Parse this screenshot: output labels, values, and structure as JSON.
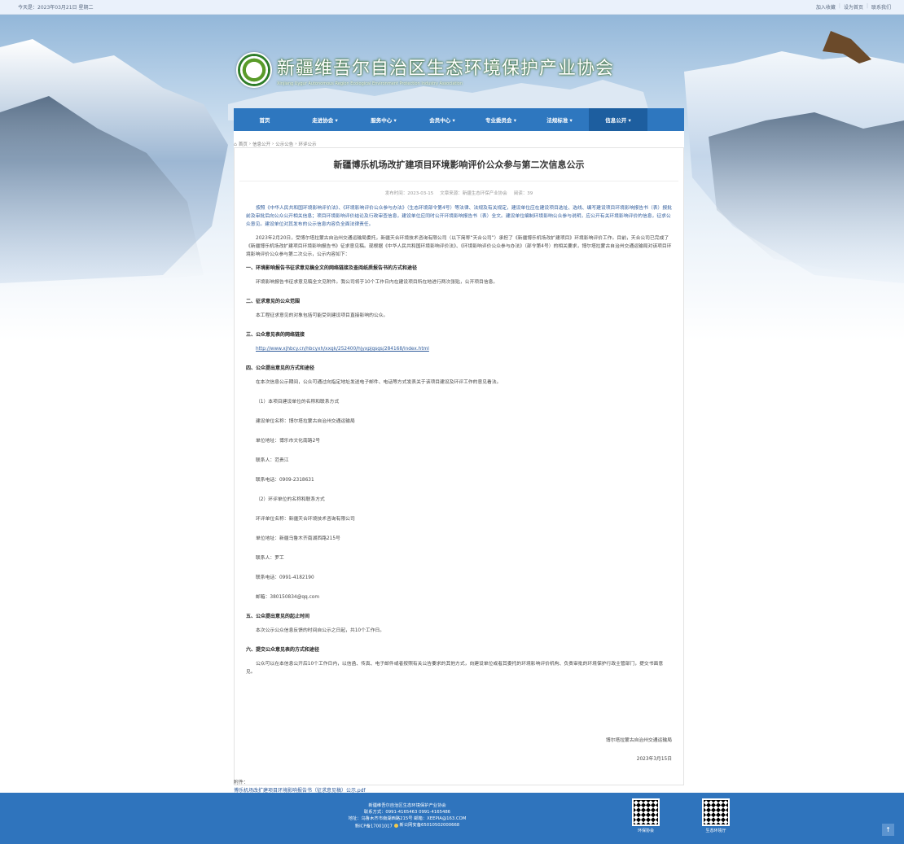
{
  "topbar": {
    "date": "今天是：2023年03月21日 星期二",
    "links": [
      "加入收藏",
      "设为首页",
      "联系我们"
    ]
  },
  "logo": {
    "title": "新疆维吾尔自治区生态环境保护产业协会",
    "subtitle": "Xinjiang Uygur Autonomous Region Ecological Environment Protection Industry Association"
  },
  "nav": [
    {
      "label": "首页",
      "active": false
    },
    {
      "label": "走进协会 ▾",
      "active": false
    },
    {
      "label": "服务中心 ▾",
      "active": false
    },
    {
      "label": "会员中心 ▾",
      "active": false
    },
    {
      "label": "专业委员会 ▾",
      "active": false
    },
    {
      "label": "法规标准 ▾",
      "active": false
    },
    {
      "label": "信息公开 ▾",
      "active": true
    }
  ],
  "breadcrumb": [
    "首页",
    "信息公开",
    "公示公告",
    "环评公示"
  ],
  "article": {
    "title": "新疆博乐机场改扩建项目环境影响评价公众参与第二次信息公示",
    "meta": {
      "publish": "发布时间：2023-03-15",
      "source": "文章来源：新疆生态环保产业协会",
      "views": "阅读：39"
    },
    "intro1": "按照《中华人民共和国环境影响评价法》、《环境影响评价公众参与办法》（生态环境部令第4号）等法律、法规及有关规定，建设单位应在建设项目选址、选线、编写建设项目环境影响报告书（表）报批前及审批后向公众公开相关信息；项目环境影响评价结论及行政审查信息，建设单位应同时公开环境影响报告书（表）全文。建设单位编制环境影响公众参与说明，应公开有关环境影响评价的信息，征求公众意见。建设单位对其发布的公示信息内容负全面法律责任。",
    "intro2": "2023年2月20日，受博尔塔拉蒙古自治州交通运输局委托，新疆天合环境技术咨询有限公司（以下简称“天合公司”）承担了《新疆博乐机场改扩建项目》环境影响评价工作。目前，天合公司已完成了《新疆博乐机场改扩建项目环境影响报告书》征求意见稿。现根据《中华人民共和国环境影响评价法》、《环境影响评价公众参与办法》（部令第4号）的相关要求，博尔塔拉蒙古自治州交通运输局对该项目环境影响评价公众参与第二次公示，公示内容如下：",
    "s1_title": "一、环境影响报告书征求意见稿全文的网络链接及查阅纸质报告书的方式和途径",
    "s1_body": "环境影响报告书征求意见稿全文见附件。我公司将于10个工作日内在建设项目所在地进行两次张贴，公开项目信息。",
    "s2_title": "二、征求意见的公众范围",
    "s2_body": "本工程征求意见的对象包括可能受到建设项目直接影响的公众。",
    "s3_title": "三、公众意见表的网络链接",
    "s3_link": "http://www.xjhbcy.cn/hbcyxh/xxgk/252400/hjyxpjgsgs/284168/index.html",
    "s4_title": "四、公众提出意见的方式和途径",
    "s4_body": "在本次信息公示期间，公众可通过向指定地址发送电子邮件、电话等方式发表关于该项目建设及环评工作的意见看法。",
    "s4_sub1": "（1）本项目建设单位的名称和联系方式",
    "s4_lines1": [
      "建设单位名称：博尔塔拉蒙古自治州交通运输局",
      "单位地址：博乐市文化南路2号",
      "联系人：范贵江",
      "联系电话：0909-2318631"
    ],
    "s4_sub2": "（2）环评单位的名称和联系方式",
    "s4_lines2": [
      "环评单位名称：新疆天合环境技术咨询有限公司",
      "单位地址：新疆乌鲁木齐南湖西路215号",
      "联系人：罗工",
      "联系电话：0991-4182190",
      "邮箱：380150834@qq.com"
    ],
    "s5_title": "五、公众提出意见的起止时间",
    "s5_body": "本次公示公众信息反馈的时间自公示之日起，共10个工作日。",
    "s6_title": "六、提交公众意见表的方式和途径",
    "s6_body": "公众可以在本信息公开后10个工作日内，以信函、传真、电子邮件或者按照有关公告要求的其他方式，向建设单位或者其委托的环境影响评价机构、负责审批的环境保护行政主管部门，提交书面意见。",
    "sign_org": "博尔塔拉蒙古自治州交通运输局",
    "sign_date": "2023年3月15日",
    "attach_label": "附件：",
    "attach_file": "博乐机场改扩建项目环境影响报告书（征求意见稿）公示.pdf"
  },
  "footer": {
    "org": "新疆维吾尔自治区生态环境保护产业协会",
    "phone": "联系方式：0991-4165463 0991-4165486",
    "address": "地址：乌鲁木齐市南湖西路215号 邮箱：XEEPIA@163.COM",
    "icp": "新ICP备17001017",
    "police": "新公网安备65010502000668",
    "qr1": "环保协会",
    "qr2": "生态环境厅"
  },
  "colors": {
    "nav": "#2e77bf",
    "nav_active": "#1d5e9f",
    "footer": "#2f74bd",
    "link": "#2d5a9a"
  },
  "icons": {
    "home": "home-icon",
    "back_top": "arrow-up-icon"
  }
}
